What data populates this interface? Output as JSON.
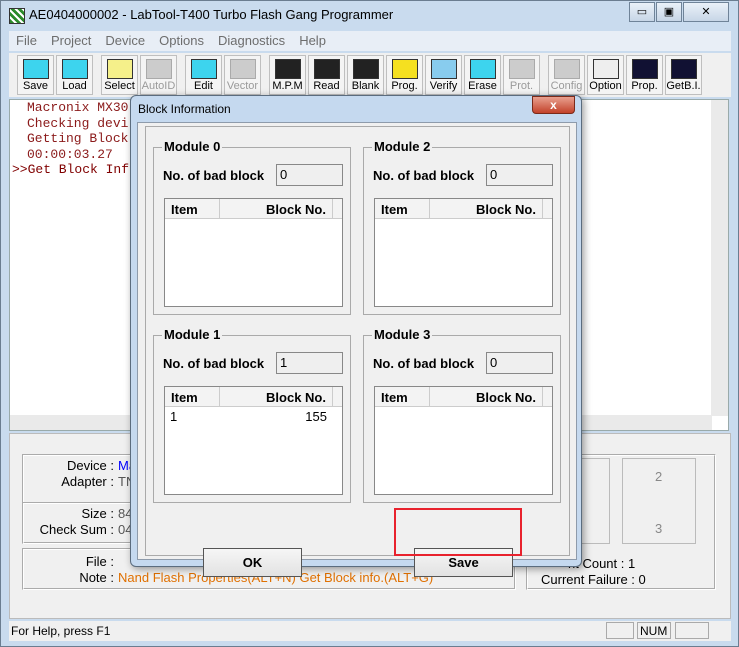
{
  "window": {
    "title": "AE0404000002 - LabTool-T400 Turbo Flash Gang Programmer",
    "min": "▭",
    "max": "▣",
    "close": "✕"
  },
  "menu": [
    "File",
    "Project",
    "Device",
    "Options",
    "Diagnostics",
    "Help"
  ],
  "toolbar": [
    {
      "label": "Save",
      "icon": "save-icon",
      "enabled": true
    },
    {
      "label": "Load",
      "icon": "load-icon",
      "enabled": true
    },
    {
      "label": "Select",
      "icon": "select-icon",
      "enabled": true,
      "gap": true
    },
    {
      "label": "AutoID",
      "icon": "autoid-icon",
      "enabled": false
    },
    {
      "label": "Edit",
      "icon": "edit-icon",
      "enabled": true,
      "gap": true
    },
    {
      "label": "Vector",
      "icon": "vector-icon",
      "enabled": false
    },
    {
      "label": "M.P.M",
      "icon": "mpm-icon",
      "enabled": true,
      "gap": true
    },
    {
      "label": "Read",
      "icon": "read-icon",
      "enabled": true
    },
    {
      "label": "Blank",
      "icon": "blank-icon",
      "enabled": true
    },
    {
      "label": "Prog.",
      "icon": "program-icon",
      "enabled": true
    },
    {
      "label": "Verify",
      "icon": "verify-icon",
      "enabled": true
    },
    {
      "label": "Erase",
      "icon": "erase-icon",
      "enabled": true
    },
    {
      "label": "Prot.",
      "icon": "protect-icon",
      "enabled": false
    },
    {
      "label": "Config",
      "icon": "config-icon",
      "enabled": false,
      "gap": true
    },
    {
      "label": "Option",
      "icon": "option-icon",
      "enabled": true
    },
    {
      "label": "Prop.",
      "icon": "nand-properties-icon",
      "enabled": true
    },
    {
      "label": "GetB.I.",
      "icon": "get-block-info-icon",
      "enabled": true
    }
  ],
  "log": [
    "Macronix MX30",
    "Checking devi",
    "Getting Block",
    "00:00:03.27",
    ">>Get Block Inf"
  ],
  "info": {
    "device_label": "Device :",
    "device_value": "Ma",
    "adapter_label": "Adapter :",
    "adapter_value": "TN",
    "size_label": "Size :",
    "size_value": "84",
    "checksum_label": "Check Sum :",
    "checksum_value": "04",
    "file_label": "File :",
    "file_value": "",
    "note_label": "Note :",
    "note_value": "Nand Flash Properties(ALT+N) Get Block info.(ALT+G)",
    "count_text": "nt Count : 1",
    "failure_text": "Current Failure : 0",
    "socket_2": "2",
    "socket_3": "3"
  },
  "statusbar": {
    "help": "For Help, press F1",
    "num": "NUM"
  },
  "dialog": {
    "title": "Block Information",
    "bad_block_label": "No. of bad block",
    "col_item": "Item",
    "col_block": "Block No.",
    "modules": [
      {
        "name": "Module 0",
        "bad": "0",
        "rows": []
      },
      {
        "name": "Module 2",
        "bad": "0",
        "rows": []
      },
      {
        "name": "Module 1",
        "bad": "1",
        "rows": [
          {
            "item": "1",
            "block": "155"
          }
        ]
      },
      {
        "name": "Module 3",
        "bad": "0",
        "rows": []
      }
    ],
    "ok": "OK",
    "save": "Save"
  },
  "colors": {
    "note": "#e07000",
    "device": "#0000ff",
    "highlight": "#e8222d"
  }
}
